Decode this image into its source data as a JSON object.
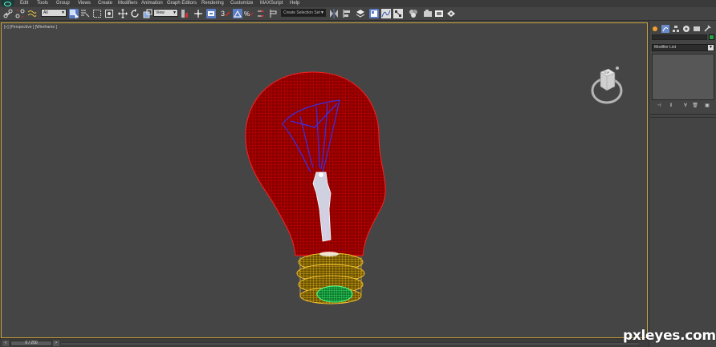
{
  "menubar": {
    "items": [
      "Edit",
      "Tools",
      "Group",
      "Views",
      "Create",
      "Modifiers",
      "Animation",
      "Graph Editors",
      "Rendering",
      "Customize",
      "MAXScript",
      "Help"
    ]
  },
  "toolbar": {
    "selection_filter": "All",
    "reference_coord": "View",
    "named_selection": "Create Selection Set",
    "snap_label": "3",
    "icons": [
      "select-link-icon",
      "unlink-icon",
      "bind-spacewarp-icon",
      "select-object-icon",
      "select-by-name-icon",
      "rect-selection-icon",
      "window-crossing-icon",
      "move-icon",
      "rotate-icon",
      "scale-icon",
      "pivot-icon",
      "manipulate-icon",
      "keyboard-shortcut-icon",
      "snaps-icon",
      "angle-snap-icon",
      "percent-snap-icon",
      "spinner-snap-icon",
      "edit-named-sets-icon",
      "mirror-icon",
      "align-icon",
      "layer-manager-icon",
      "graphite-icon",
      "curve-editor-icon",
      "schematic-view-icon",
      "material-editor-icon",
      "render-setup-icon",
      "rendered-frame-icon",
      "render-icon"
    ]
  },
  "viewport": {
    "label": "[+] [Perspective ] [Wireframe ]",
    "viewcube_face": "TOP",
    "colors": {
      "glass": "#c00000",
      "filament": "#3333cc",
      "stem": "#e8e8f0",
      "base": "#d4a017",
      "contact": "#22cc55",
      "border": "#c8a43a"
    }
  },
  "command_panel": {
    "tabs": [
      "create-icon",
      "modify-icon",
      "hierarchy-icon",
      "motion-icon",
      "display-icon",
      "utilities-icon"
    ],
    "modifier_list_label": "Modifier List",
    "object_color": "#2da04a",
    "stack_buttons": [
      "pin-stack-icon",
      "show-end-result-icon",
      "make-unique-icon",
      "remove-modifier-icon",
      "configure-sets-icon"
    ]
  },
  "timebar": {
    "frame_readout": "0 / 250",
    "prev": "<",
    "next": ">"
  },
  "watermark": {
    "text": "pxleyes.com"
  }
}
